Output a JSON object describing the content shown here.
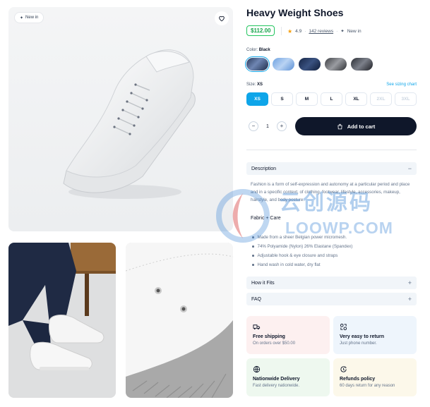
{
  "product": {
    "title": "Heavy Weight Shoes",
    "price": "$112.00",
    "rating": "4.9",
    "reviews": "142 reviews",
    "status": "New in",
    "badge": "New in"
  },
  "colors": {
    "label": "Color:",
    "selected": "Black",
    "swatch_count": 5,
    "accent": "#0ea5e9",
    "brand_dark": "#0f172a"
  },
  "sizes": {
    "label": "Size:",
    "selected": "XS",
    "chart_link": "See sizing chart",
    "options": [
      "XS",
      "S",
      "M",
      "L",
      "XL",
      "2XL",
      "3XL"
    ],
    "disabled": [
      "2XL",
      "3XL"
    ]
  },
  "cart": {
    "quantity": "1",
    "minus": "−",
    "plus": "+",
    "add_label": "Add to cart"
  },
  "accordion": {
    "description": "Description",
    "description_sign": "−",
    "description_text": "Fashion is a form of self-expression and autonomy at a particular period and place and in a specific context, of clothing, footwear, lifestyle, accessories, makeup, hairstyle, and body posture.",
    "fabric_title": "Fabric + Care",
    "fabric_items": [
      "Made from a sheer Belgian power micromesh.",
      "74% Polyamide (Nylon) 26% Elastane (Spandex)",
      "Adjustable hook & eye closure and straps",
      "Hand wash in cold water, dry flat"
    ],
    "how_it_fits": "How it Fits",
    "faq": "FAQ",
    "plus": "+"
  },
  "features": [
    {
      "title": "Free shipping",
      "sub": "On orders over $50.00",
      "icon": "truck-icon",
      "bg": "#fdf0f0"
    },
    {
      "title": "Very easy to return",
      "sub": "Just phone number.",
      "icon": "return-icon",
      "bg": "#eef5fc"
    },
    {
      "title": "Nationwide Delivery",
      "sub": "Fast delivery nationwide.",
      "icon": "globe-icon",
      "bg": "#eef8ef"
    },
    {
      "title": "Refunds policy",
      "sub": "60 days return for any reason",
      "icon": "refund-icon",
      "bg": "#fcf8ea"
    }
  ],
  "watermark": {
    "line1": "云创源码",
    "line2": "LOOWP.COM"
  }
}
